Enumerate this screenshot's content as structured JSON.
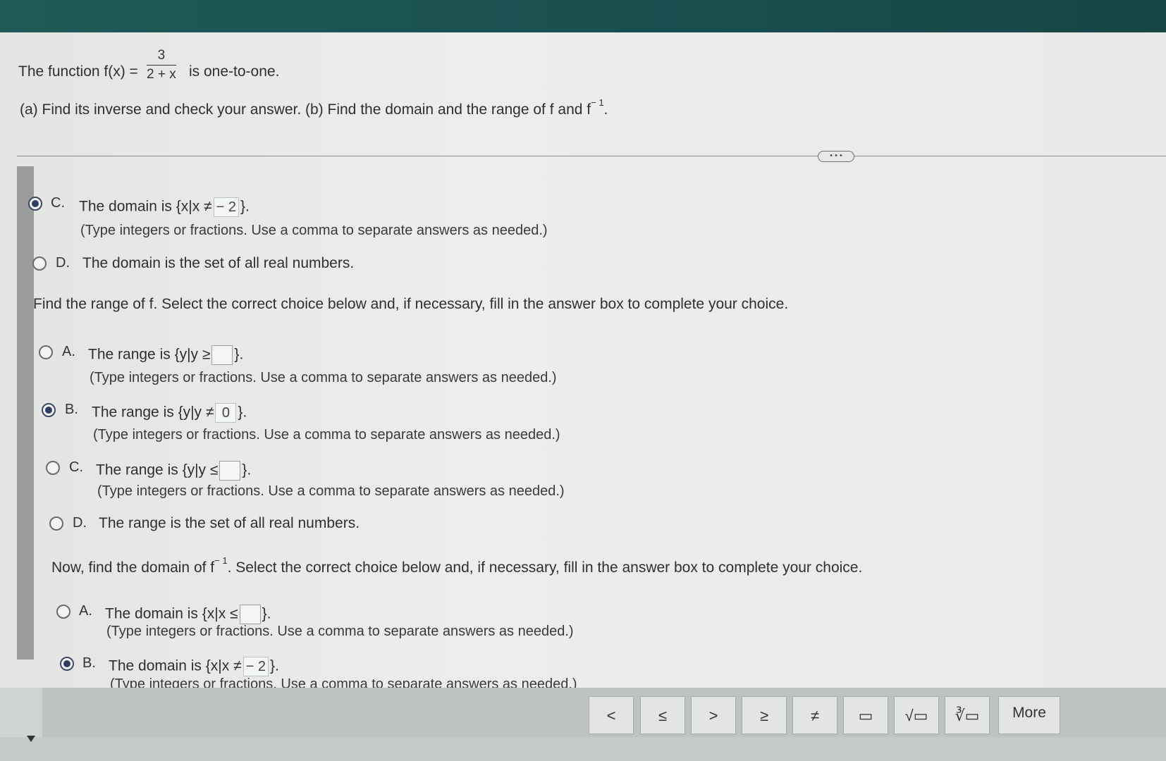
{
  "question": {
    "intro_prefix": "The function f(x) =",
    "fraction_num": "3",
    "fraction_den": "2 + x",
    "intro_suffix": "is one-to-one.",
    "task": "(a) Find its inverse and check your answer. (b) Find the domain and the range of f and f",
    "task_sup": "− 1",
    "task_end": "."
  },
  "domain_f": {
    "option_c": {
      "letter": "C.",
      "text": "The domain is",
      "set_open": "{x|x ≠",
      "value": "− 2",
      "set_close": "}",
      "hint": "(Type integers or fractions. Use a comma to separate answers as needed.)",
      "checked": true
    },
    "option_d": {
      "letter": "D.",
      "text": "The domain is the set of all real numbers.",
      "checked": false
    }
  },
  "range_f": {
    "prompt": "Find the range of f. Select the correct choice below and, if necessary, fill in the answer box to complete your choice.",
    "option_a": {
      "letter": "A.",
      "text": "The range is",
      "set_open": "{y|y ≥",
      "value": "",
      "set_close": "}",
      "hint": "(Type integers or fractions. Use a comma to separate answers as needed.)",
      "checked": false
    },
    "option_b": {
      "letter": "B.",
      "text": "The range is",
      "set_open": "{y|y ≠",
      "value": "0",
      "set_close": "}",
      "hint": "(Type integers or fractions. Use a comma to separate answers as needed.)",
      "checked": true
    },
    "option_c": {
      "letter": "C.",
      "text": "The range is",
      "set_open": "{y|y ≤",
      "value": "",
      "set_close": "}",
      "hint": "(Type integers or fractions. Use a comma to separate answers as needed.)",
      "checked": false
    },
    "option_d": {
      "letter": "D.",
      "text": "The range is the set of all real numbers.",
      "checked": false
    }
  },
  "domain_finv": {
    "prompt_start": "Now, find the domain of f",
    "prompt_sup": "− 1",
    "prompt_end": ". Select the correct choice below and, if necessary, fill in the answer box to complete your choice.",
    "option_a": {
      "letter": "A.",
      "text": "The domain is",
      "set_open": "{x|x ≤",
      "value": "",
      "set_close": "}",
      "hint": "(Type integers or fractions. Use a comma to separate answers as needed.)",
      "checked": false
    },
    "option_b": {
      "letter": "B.",
      "text": "The domain is",
      "set_open": "{x|x ≠",
      "value": "− 2",
      "set_close": "}",
      "hint": "(Type integers or fractions. Use a comma to separate answers as needed.)",
      "checked": true
    }
  },
  "toolbar": {
    "buttons": [
      "<",
      "≤",
      ">",
      "≥",
      "≠",
      "▭",
      "√▭",
      "∛▭"
    ],
    "more": "More"
  }
}
